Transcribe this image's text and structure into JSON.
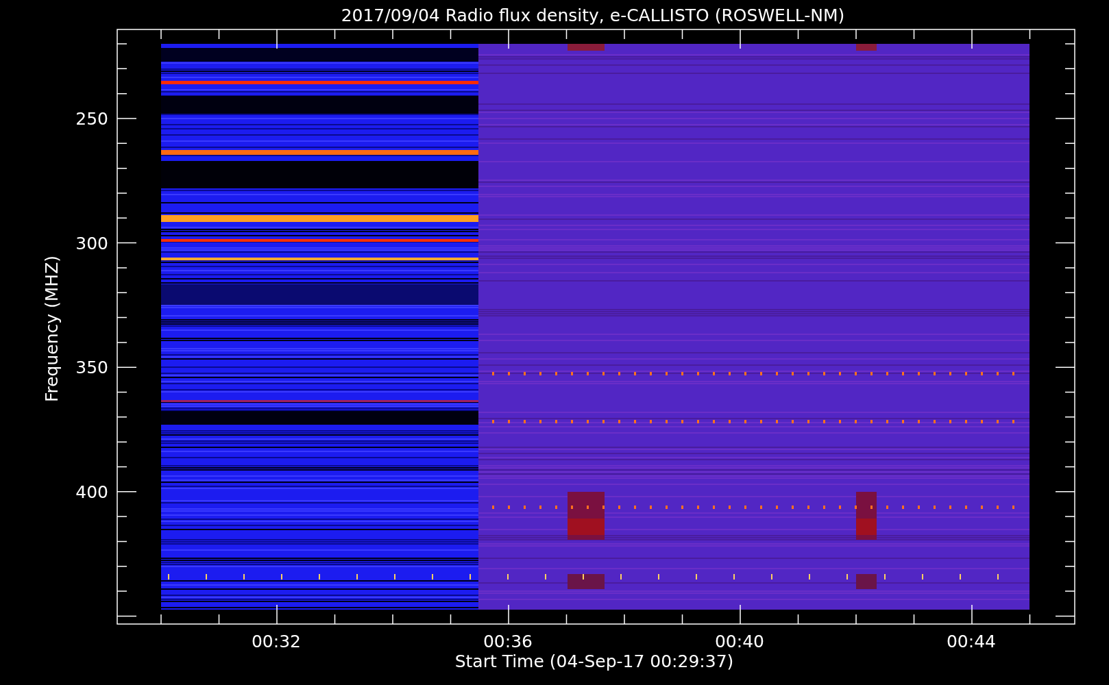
{
  "title": "2017/09/04  Radio flux density, e-CALLISTO (ROSWELL-NM)",
  "y_axis": {
    "label": "Frequency (MHZ)",
    "ticks": [
      "250",
      "300",
      "350",
      "400"
    ]
  },
  "x_axis": {
    "label": "Start Time (04-Sep-17 00:29:37)",
    "ticks": [
      "00:32",
      "00:36",
      "00:40",
      "00:44"
    ]
  }
}
